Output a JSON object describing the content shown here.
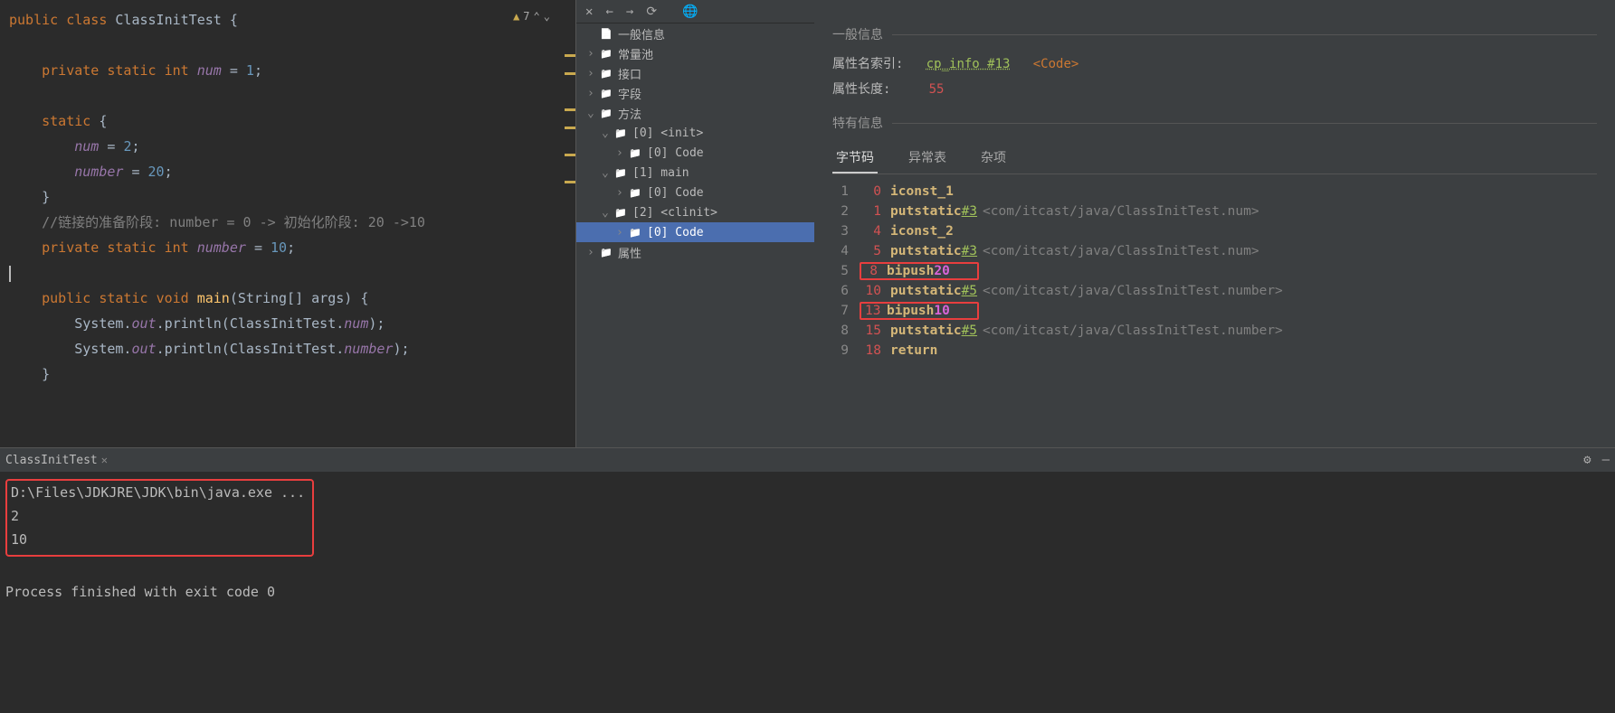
{
  "editor": {
    "warning_count": "7",
    "code": {
      "l1_public": "public",
      "l1_class": "class",
      "l1_name": "ClassInitTest",
      "l1_brace": "{",
      "l3_private": "private",
      "l3_static": "static",
      "l3_int": "int",
      "l3_field": "num",
      "l3_eq": "=",
      "l3_val": "1",
      "l3_semi": ";",
      "l5_static": "static",
      "l5_brace": "{",
      "l6_field": "num",
      "l6_eq": "=",
      "l6_val": "2",
      "l6_semi": ";",
      "l7_field": "number",
      "l7_eq": "=",
      "l7_val": "20",
      "l7_semi": ";",
      "l8_brace": "}",
      "l9_cmt": "//链接的准备阶段: number = 0 -> 初始化阶段: 20 ->10",
      "l10_private": "private",
      "l10_static": "static",
      "l10_int": "int",
      "l10_field": "number",
      "l10_eq": "=",
      "l10_val": "10",
      "l10_semi": ";",
      "l12_public": "public",
      "l12_static": "static",
      "l12_void": "void",
      "l12_main": "main",
      "l12_args": "(String[] args) {",
      "l13_sys": "System.",
      "l13_out": "out",
      "l13_print": ".println(ClassInitTest.",
      "l13_field": "num",
      "l13_end": ");",
      "l14_sys": "System.",
      "l14_out": "out",
      "l14_print": ".println(ClassInitTest.",
      "l14_field": "number",
      "l14_end": ");",
      "l15_brace": "}"
    }
  },
  "tree": {
    "n0": "一般信息",
    "n1": "常量池",
    "n2": "接口",
    "n3": "字段",
    "n4": "方法",
    "n4_0": "[0] <init>",
    "n4_0_0": "[0] Code",
    "n4_1": "[1] main",
    "n4_1_0": "[0] Code",
    "n4_2": "[2] <clinit>",
    "n4_2_0": "[0] Code",
    "n5": "属性"
  },
  "info": {
    "general_title": "一般信息",
    "attr_name_label": "属性名索引:",
    "attr_name_link": "cp_info #13",
    "attr_name_tag": "<Code>",
    "attr_len_label": "属性长度:",
    "attr_len_val": "55",
    "special_title": "特有信息",
    "tabs": {
      "t0": "字节码",
      "t1": "异常表",
      "t2": "杂项"
    }
  },
  "bytecode": [
    {
      "line": "1",
      "off": "0",
      "instr": "iconst_1",
      "ref": "",
      "cmt": ""
    },
    {
      "line": "2",
      "off": "1",
      "instr": "putstatic",
      "ref": "#3",
      "cmt": "<com/itcast/java/ClassInitTest.num>"
    },
    {
      "line": "3",
      "off": "4",
      "instr": "iconst_2",
      "ref": "",
      "cmt": ""
    },
    {
      "line": "4",
      "off": "5",
      "instr": "putstatic",
      "ref": "#3",
      "cmt": "<com/itcast/java/ClassInitTest.num>"
    },
    {
      "line": "5",
      "off": "8",
      "instr": "bipush",
      "arg": "20",
      "hl": true
    },
    {
      "line": "6",
      "off": "10",
      "instr": "putstatic",
      "ref": "#5",
      "cmt": "<com/itcast/java/ClassInitTest.number>"
    },
    {
      "line": "7",
      "off": "13",
      "instr": "bipush",
      "arg": "10",
      "hl": true
    },
    {
      "line": "8",
      "off": "15",
      "instr": "putstatic",
      "ref": "#5",
      "cmt": "<com/itcast/java/ClassInitTest.number>"
    },
    {
      "line": "9",
      "off": "18",
      "instr": "return",
      "ref": "",
      "cmt": ""
    }
  ],
  "run": {
    "tab_name": "ClassInitTest",
    "out_l1": "D:\\Files\\JDKJRE\\JDK\\bin\\java.exe ...",
    "out_l2": "2",
    "out_l3": "10",
    "out_l5": "Process finished with exit code 0"
  }
}
